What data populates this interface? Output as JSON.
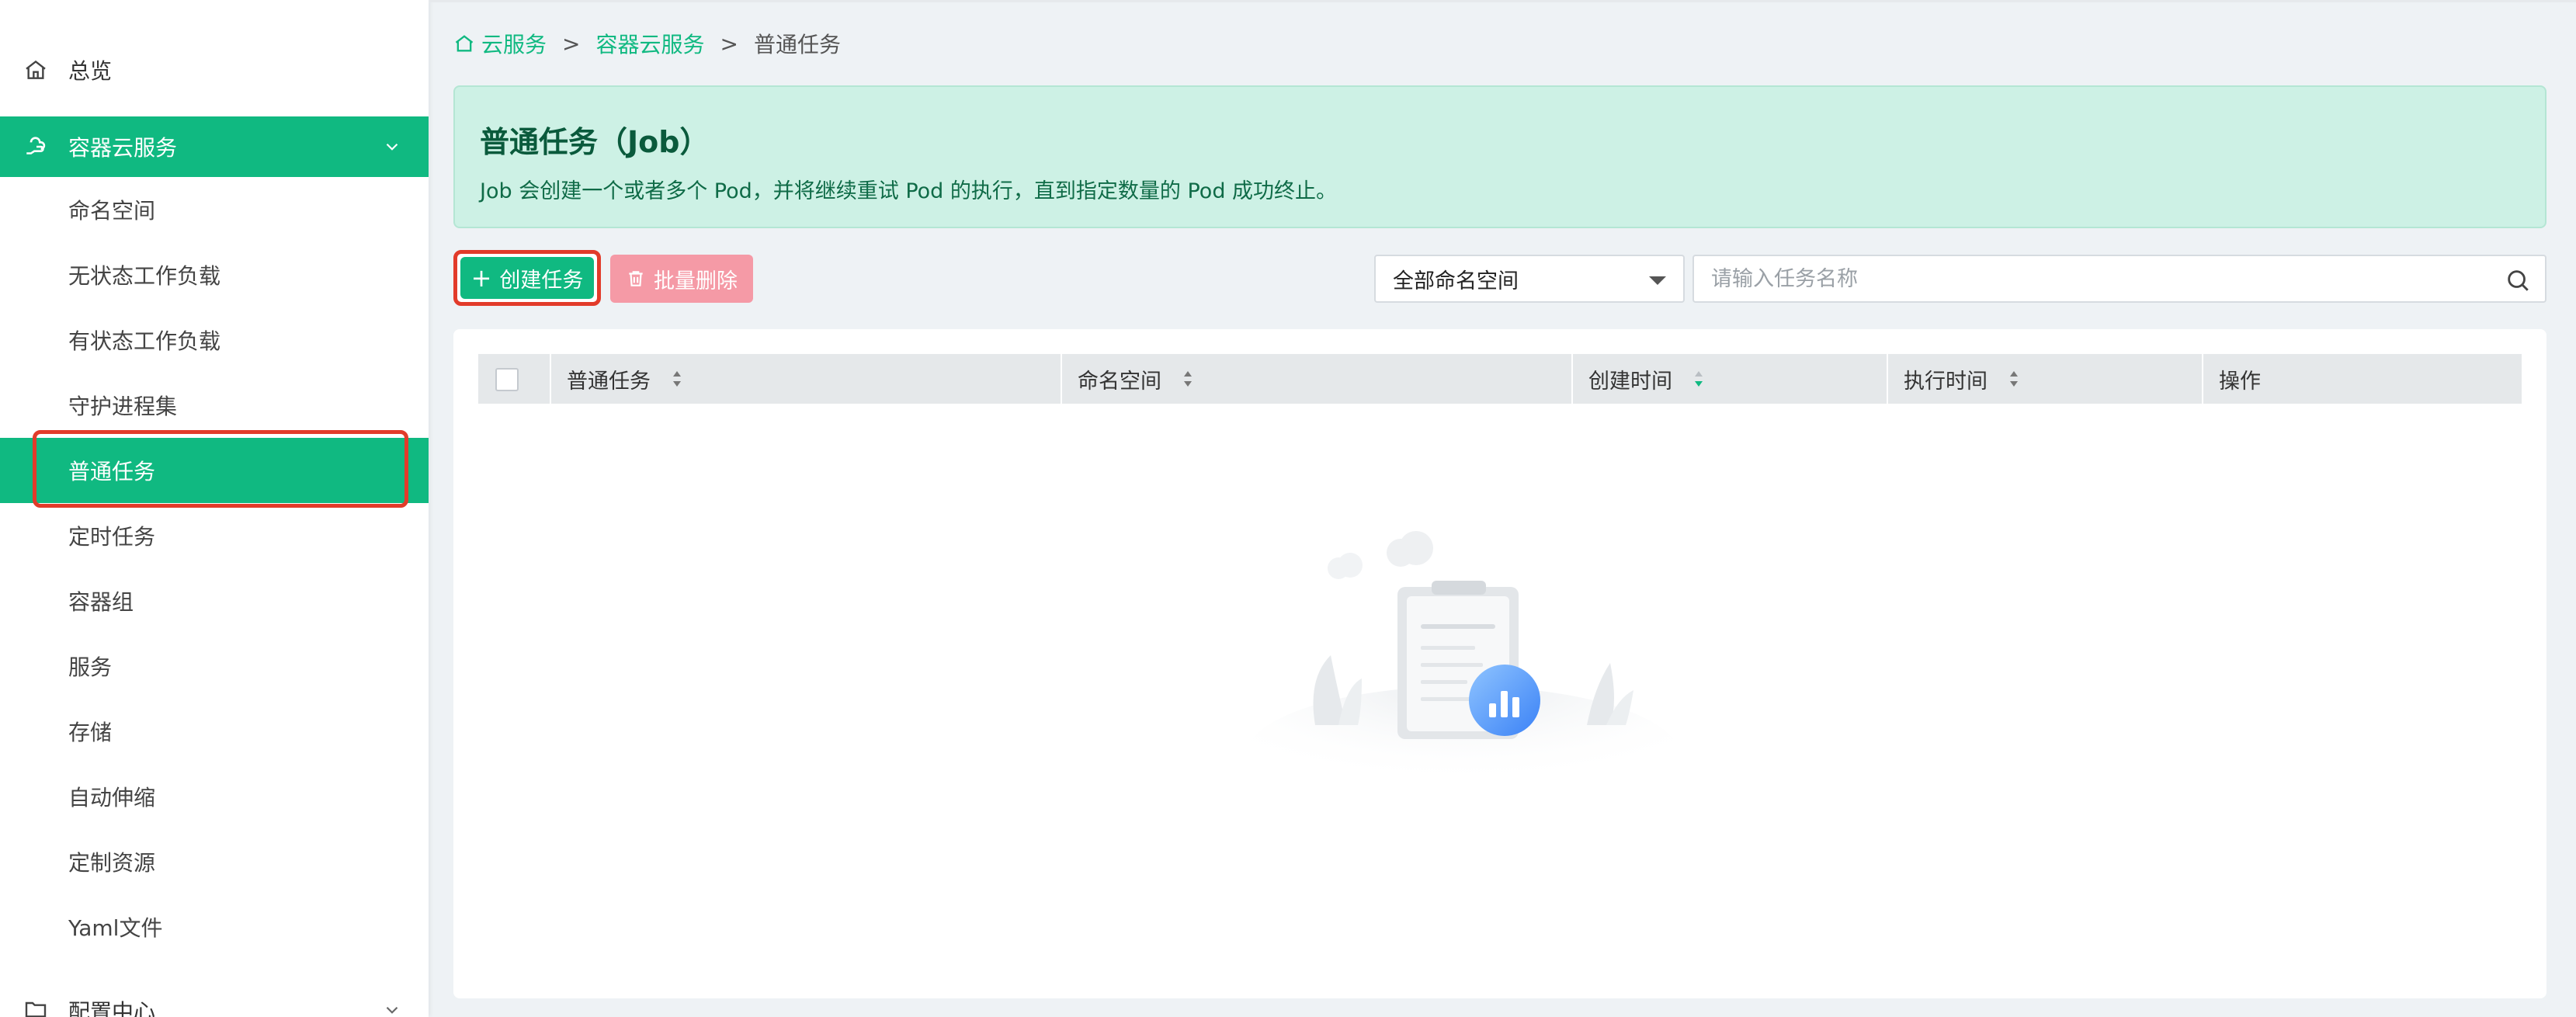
{
  "sidebar": {
    "overview": {
      "label": "总览",
      "icon": "home-icon"
    },
    "group": {
      "label": "容器云服务",
      "icon": "cloud-hand-icon",
      "expanded": true
    },
    "items": [
      {
        "label": "命名空间",
        "active": false
      },
      {
        "label": "无状态工作负载",
        "active": false
      },
      {
        "label": "有状态工作负载",
        "active": false
      },
      {
        "label": "守护进程集",
        "active": false
      },
      {
        "label": "普通任务",
        "active": true
      },
      {
        "label": "定时任务",
        "active": false
      },
      {
        "label": "容器组",
        "active": false
      },
      {
        "label": "服务",
        "active": false
      },
      {
        "label": "存储",
        "active": false
      },
      {
        "label": "自动伸缩",
        "active": false
      },
      {
        "label": "定制资源",
        "active": false
      },
      {
        "label": "Yaml文件",
        "active": false
      }
    ],
    "config_center": {
      "label": "配置中心",
      "icon": "folder-icon"
    }
  },
  "breadcrumb": {
    "items": [
      "云服务",
      "容器云服务",
      "普通任务"
    ],
    "separator": ">"
  },
  "banner": {
    "title": "普通任务（Job）",
    "description": "Job 会创建一个或者多个 Pod，并将继续重试 Pod 的执行，直到指定数量的 Pod 成功终止。"
  },
  "toolbar": {
    "create_label": "创建任务",
    "delete_label": "批量删除",
    "namespace_select": "全部命名空间",
    "search_placeholder": "请输入任务名称"
  },
  "table": {
    "columns": [
      "普通任务",
      "命名空间",
      "创建时间",
      "执行时间",
      "操作"
    ],
    "rows": []
  },
  "colors": {
    "accent": "#10b981",
    "banner_bg": "#cdf1e5",
    "danger_light": "#f59aa6",
    "highlight": "#e23b2a"
  }
}
